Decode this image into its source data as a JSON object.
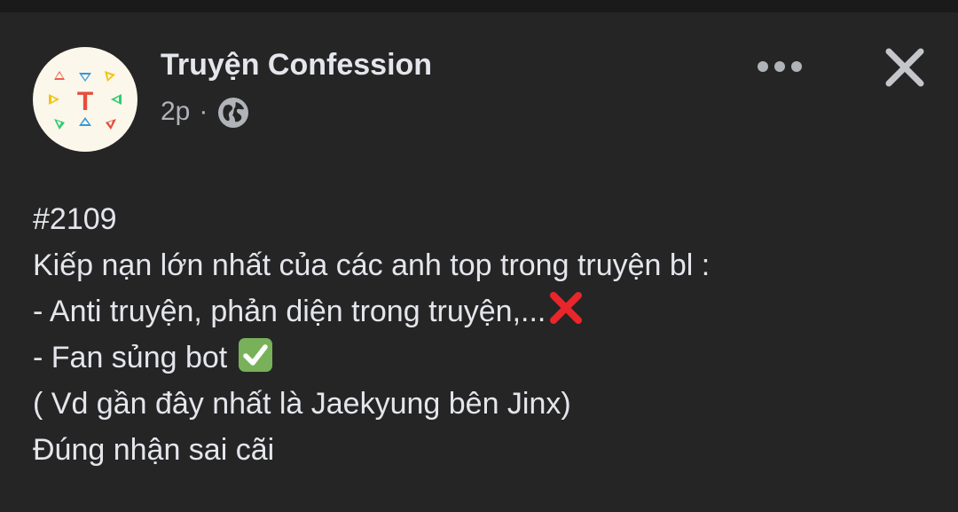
{
  "header": {
    "page_name": "Truyện Confession",
    "timestamp": "2p",
    "separator": "·",
    "audience_icon": "globe-icon",
    "avatar_letter": "T",
    "more_icon": "more-horizontal-icon",
    "close_icon": "close-icon"
  },
  "post": {
    "lines": [
      "#2109",
      "Kiếp nạn lớn nhất của các anh top trong truyện bl :",
      "- Anti truyện, phản diện trong truyện,...",
      "- Fan sủng bot ",
      "( Vd gần đây nhất là Jaekyung bên Jinx)",
      "Đúng nhận sai cãi"
    ],
    "line3_emoji": "cross-mark-emoji",
    "line4_emoji": "check-mark-button-emoji"
  },
  "colors": {
    "background": "#252526",
    "text_primary": "#e4e6eb",
    "text_secondary": "#b0b3b8",
    "cross_red": "#e8262b",
    "check_green": "#78b159"
  }
}
